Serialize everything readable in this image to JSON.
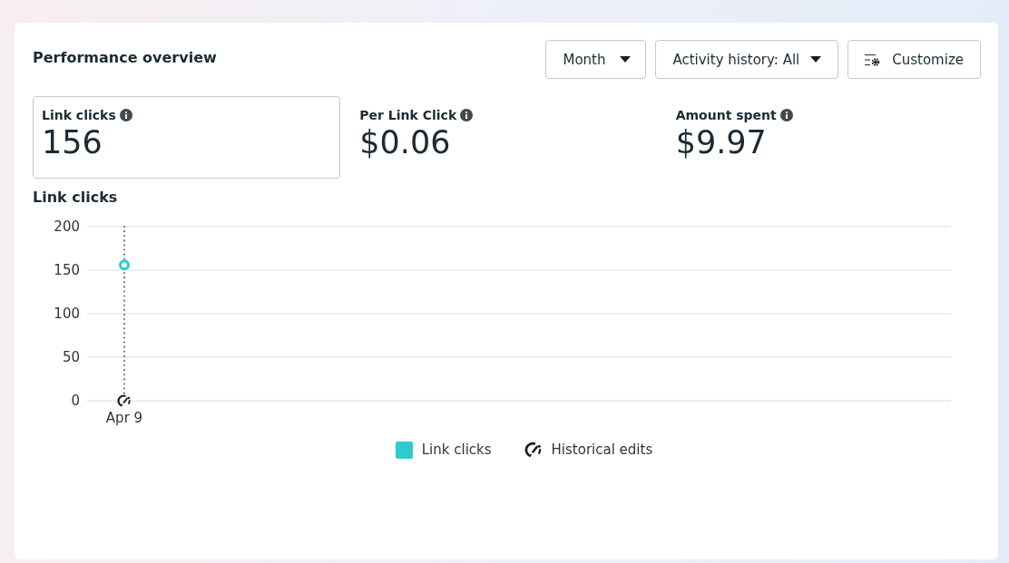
{
  "panel": {
    "title": "Performance overview",
    "controls": [
      {
        "kind": "dropdown",
        "label": "Month"
      },
      {
        "kind": "dropdown",
        "label": "Activity history: All"
      },
      {
        "kind": "customize",
        "label": "Customize"
      }
    ],
    "metrics": [
      {
        "label": "Link clicks",
        "value": "156",
        "selected": true
      },
      {
        "label": "Per Link Click",
        "value": "$0.06",
        "selected": false
      },
      {
        "label": "Amount spent",
        "value": "$9.97",
        "selected": false
      }
    ],
    "chart_title": "Link clicks",
    "chart_data": {
      "type": "line",
      "categories": [
        "Apr 9"
      ],
      "series": [
        {
          "name": "Link clicks",
          "color": "#2ecbce",
          "values": [
            156
          ],
          "marker": "o"
        }
      ],
      "ylim": [
        0,
        200
      ],
      "yticks": [
        0,
        50,
        100,
        150,
        200
      ],
      "grid": true,
      "ref_lines": [
        {
          "axis": "x",
          "value": "Apr 9"
        }
      ]
    },
    "edits_legend": "Historical edits"
  }
}
